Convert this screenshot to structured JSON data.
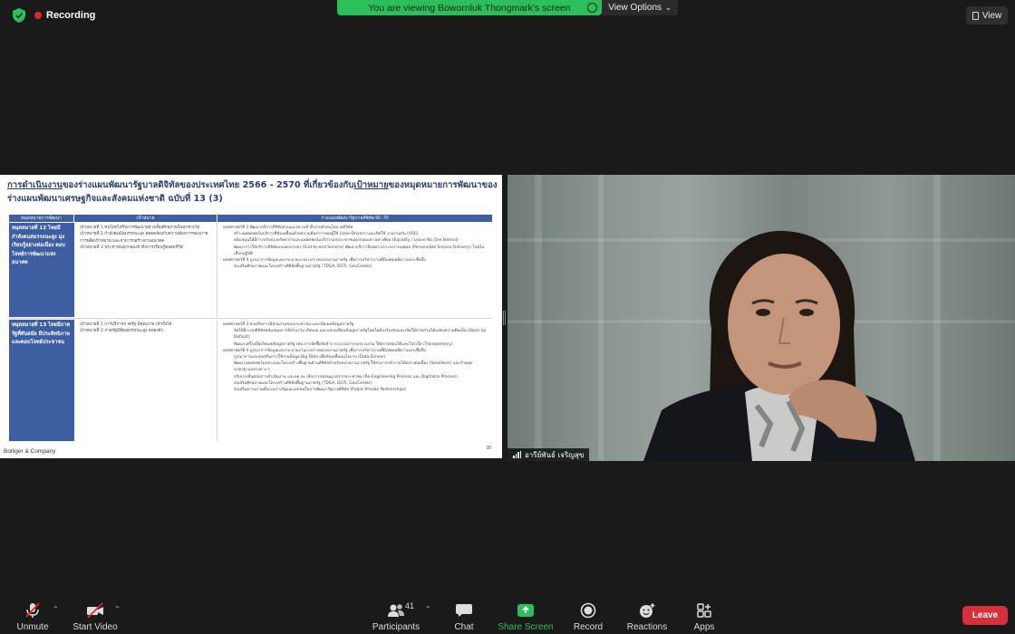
{
  "top": {
    "recording_label": "Recording",
    "banner_text": "You are viewing Bowornluk Thongmark's screen",
    "view_options_label": "View Options",
    "view_label": "View"
  },
  "slide": {
    "title_pre": "การดำเนินงาน",
    "title_mid1": "ของร่างแผนพัฒนารัฐบาลดิจิทัลของประเทศไทย 2566 - 2570 ที่เกี่ยวข้องกับ",
    "title_key": "เป้าหมาย",
    "title_mid2": "ของหมุดหมายการพัฒนาของ",
    "title_line2": "ร่างแผนพัฒนาเศรษฐกิจและสังคมแห่งชาติ ฉบับที่ 13 (3)",
    "headers": [
      "หมุดหมายการพัฒนา",
      "เป้าหมาย",
      "ร่างแผนพัฒนารัฐบาลดิจิทัล 66 -70"
    ],
    "rows": [
      {
        "goal": "หมุดหมายที่ 12 ไทยมีกำลังคนสมรรถนะสูง มุ่งเรียนรู้อย่างต่อเนื่อง ตอบโจทย์การพัฒนาแห่งอนาคต",
        "targets": [
          "เป้าหมายที่ 1 คนไทยได้รับการพัฒนาอย่างเต็มศักยภาพในทุกช่วงวัย",
          "เป้าหมายที่ 2 กำลังคนมีสมรรถนะสูง สอดคล้องกับความต้องการของภาคการผลิตเป้าหมาย และสามารถสร้างงานอนาคต",
          "เป้าหมายที่ 3 ประชาชนทุกกลุ่มเข้าถึงการเรียนรู้ตลอดชีวิต"
        ],
        "plans": [
          "ยุทธศาสตร์ที่ 1 พัฒนาบริการดิจิทัลตามแนวทางเข้าถึงง่ายด้วยนโยบายดิจิทัล",
          "สร้างแพลตฟอร์มบริการที่ขับเคลื่อนด้วยความต้องการของผู้ใช้ (User-Driven) และเปิดใช้ งานร่วมกัน (OSS)",
          "สนับสนุนให้มีการปรับปรุงทรัพยากรและแพลตฟอร์มบริการแก่ประชาชนทุกกลุ่มอย่างเท่าเทียม (Equality / Leave No One Behind)",
          "พัฒนาการให้บริการดิจิทัลแบบครบวงจร (End-to-end Service) พัฒนาบริการที่เฉพาะเจาะจงรายบุคคล (Personalize Service Delivery) โดยไม่เลือกปฏิบัติ",
          "ยุทธศาสตร์ที่ 4 บูรณาการข้อมูลและกระบวนงานระหว่างหน่วยงานภาครัฐ เพื่อการบริหารงานที่มีเหตุผลมีความน่าเชื่อถือ",
          "ส่งเสริมศักยภาพและโครงสร้างดิจิทัลพื้นฐานภาครัฐ (TDGA, DGTi, GovCenter)"
        ]
      },
      {
        "goal": "หมุดหมายที่ 13 ไทยมีภาครัฐที่ทันสมัย มีประสิทธิภาพ และตอบโจทย์ประชาชน",
        "targets": [
          "เป้าหมายที่ 1 การบริการภาครัฐ มีคุณภาพ เข้าถึงได้",
          "เป้าหมายที่ 2 ภาครัฐมีขีดสมรรถนะสูง คล่องตัว"
        ],
        "plans": [
          "ยุทธศาสตร์ที่ 3 ส่งเสริมการมีส่วนร่วมของประชาชน และเปิดเผยข้อมูลภาครัฐ",
          "จัดให้มีระบบดิจิทัลสนับสนุนการมีส่วนร่วม เปิดเผย และแลกเปลี่ยนข้อมูลภาครัฐโดยไม่ต้องร้องขอและเปิดให้ภาคส่วนได้แสดงความคิดเห็น (Open by Default)",
          "พัฒนาเครื่องมือเปิดเผยข้อมูลภาครัฐ เช่น การจัดซื้อจัดจ้าง กระบวนการงบประมาณ ให้ตรวจสอบได้และโปร่งใส (Transparency)",
          "ยุทธศาสตร์ที่ 4 บูรณาการข้อมูลและกระบวนงานระหว่างหน่วยงานภาครัฐ เพื่อการบริหารงานที่มีเหตุผลมีความน่าเชื่อถือ",
          "บูรณาการและส่งเสริมการใช้งานข้อมูล Big Data เพื่อขับเคลื่อนนโยบาย (Data-Driven)",
          "พัฒนาแพลตฟอร์มกลางและโครงสร้างพื้นฐานด้านดิจิทัลสำหรับหน่วยงานภาครัฐ ให้สามารถทำงานได้อย่างต่อเนื่อง (Seamless) และกำหนดมาตรฐานกลางต่าง ๆ",
          "ปรับปรุงขั้นตอนการดำเนินงาน และลด ละ เลิกการขออนุญาตจากประชาชน (Re-Engineering Process และ Digitalize Process)",
          "ส่งเสริมศักยภาพและโครงสร้างดิจิทัลพื้นฐานภาครัฐ (TDGA, DGTi, GovCenter)",
          "ส่งเสริมความร่วมมือระหว่างรัฐและเอกชนในการพัฒนารัฐบาลดิจิทัล (Public-Private Partnerships)"
        ]
      }
    ],
    "logo": "Bolliger & Company",
    "page_number": "38"
  },
  "video": {
    "participant_name": "อารีย์พันธ์ เจริญสุข"
  },
  "toolbar": {
    "unmute": "Unmute",
    "start_video": "Start Video",
    "participants": "Participants",
    "participants_count": "41",
    "chat": "Chat",
    "share_screen": "Share Screen",
    "record": "Record",
    "reactions": "Reactions",
    "apps": "Apps",
    "leave": "Leave"
  }
}
